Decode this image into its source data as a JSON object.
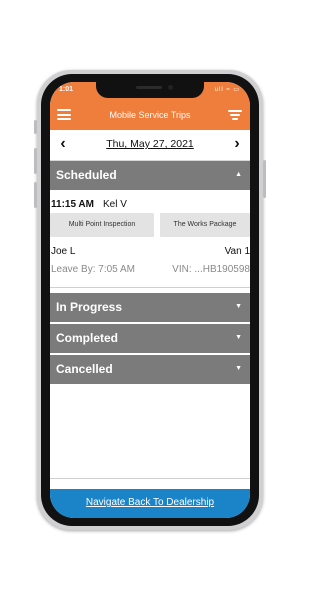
{
  "status": {
    "time": "1:01",
    "icons": "ull ≈ ▭"
  },
  "header": {
    "title": "Mobile Service Trips",
    "menu_icon": "hamburger-menu-icon",
    "filter_icon": "filter-icon"
  },
  "datebar": {
    "prev": "‹",
    "date": "Thu, May 27, 2021",
    "next": "›"
  },
  "sections": [
    {
      "label": "Scheduled",
      "caret": "▲"
    },
    {
      "label": "In Progress",
      "caret": "▼"
    },
    {
      "label": "Completed",
      "caret": "▼"
    },
    {
      "label": "Cancelled",
      "caret": "▼"
    }
  ],
  "trip": {
    "time": "11:15 AM",
    "advisor": "Kel V",
    "packages": [
      "Multi Point Inspection",
      "The Works Package"
    ],
    "customer": "Joe L",
    "vehicle": "Van 1",
    "leave_by": "Leave By: 7:05 AM",
    "vin": "VIN: ...HB190598"
  },
  "footer": {
    "link": "Navigate Back To Dealership"
  },
  "colors": {
    "header": "#ef7d3c",
    "section": "#7b7b7b",
    "footer": "#1b84c8"
  }
}
